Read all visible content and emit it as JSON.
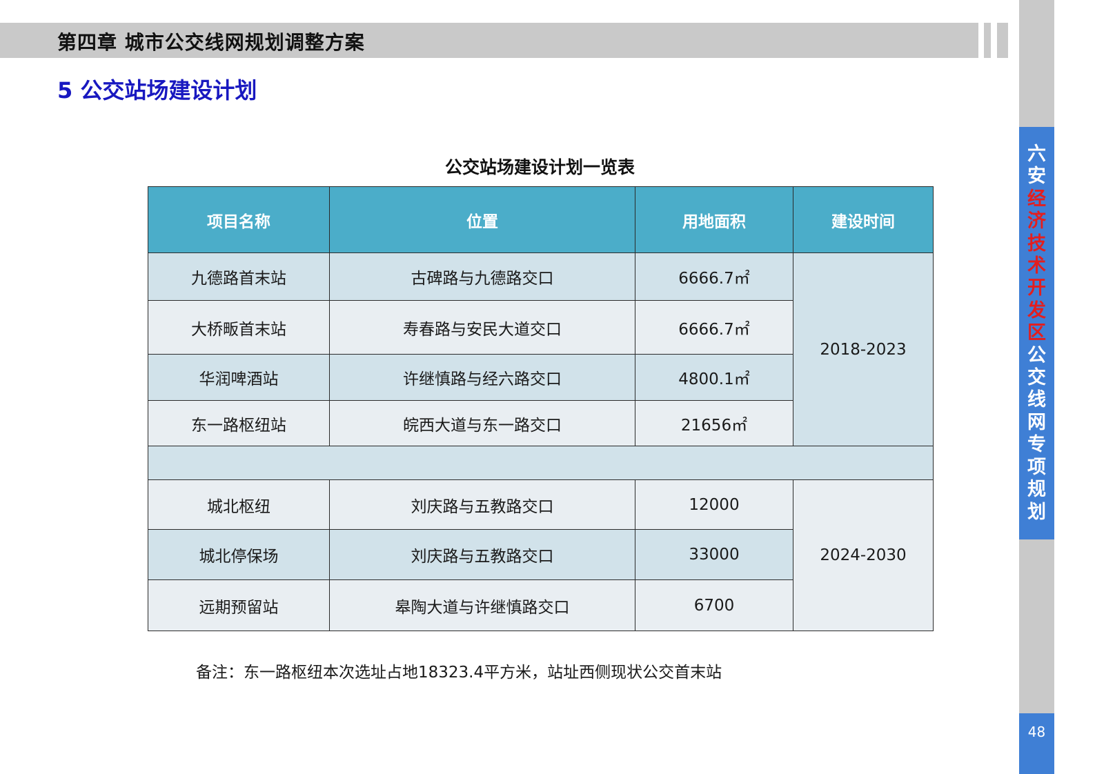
{
  "header": {
    "chapter": "第四章  城市公交线网规划调整方案",
    "section": "5 公交站场建设计划"
  },
  "side_panel": {
    "chars": [
      {
        "t": "六",
        "red": false
      },
      {
        "t": "安",
        "red": false
      },
      {
        "t": "经",
        "red": true
      },
      {
        "t": "济",
        "red": true
      },
      {
        "t": "技",
        "red": true
      },
      {
        "t": "术",
        "red": true
      },
      {
        "t": "开",
        "red": true
      },
      {
        "t": "发",
        "red": true
      },
      {
        "t": "区",
        "red": true
      },
      {
        "t": "公",
        "red": false
      },
      {
        "t": "交",
        "red": false
      },
      {
        "t": "线",
        "red": false
      },
      {
        "t": "网",
        "red": false
      },
      {
        "t": "专",
        "red": false
      },
      {
        "t": "项",
        "red": false
      },
      {
        "t": "规",
        "red": false
      },
      {
        "t": "划",
        "red": false
      }
    ]
  },
  "table": {
    "caption": "公交站场建设计划一览表",
    "headers": [
      "项目名称",
      "位置",
      "用地面积",
      "建设时间"
    ],
    "group1_period": "2018-2023",
    "group1": [
      {
        "name": "九德路首末站",
        "location": "古碑路与九德路交口",
        "area": "6666.7㎡"
      },
      {
        "name": "大桥畈首末站",
        "location": "寿春路与安民大道交口",
        "area": "6666.7㎡"
      },
      {
        "name": "华润啤酒站",
        "location": "许继慎路与经六路交口",
        "area": "4800.1㎡"
      },
      {
        "name": "东一路枢纽站",
        "location": "皖西大道与东一路交口",
        "area": "21656㎡"
      }
    ],
    "group2_period": "2024-2030",
    "group2": [
      {
        "name": "城北枢纽",
        "location": "刘庆路与五教路交口",
        "area": "12000"
      },
      {
        "name": "城北停保场",
        "location": "刘庆路与五教路交口",
        "area": "33000"
      },
      {
        "name": "远期预留站",
        "location": "皋陶大道与许继慎路交口",
        "area": "6700"
      }
    ]
  },
  "note": "备注：东一路枢纽本次选址占地18323.4平方米，站址西侧现状公交首末站",
  "page_number": "48",
  "colors": {
    "header_bar": "#c9c9c9",
    "section_title": "#1818c0",
    "table_header": "#4badc9",
    "row_dark": "#d1e2ea",
    "row_light": "#e9eef2",
    "side_blue": "#3f7fd5",
    "side_red_text": "#e31e1e"
  }
}
